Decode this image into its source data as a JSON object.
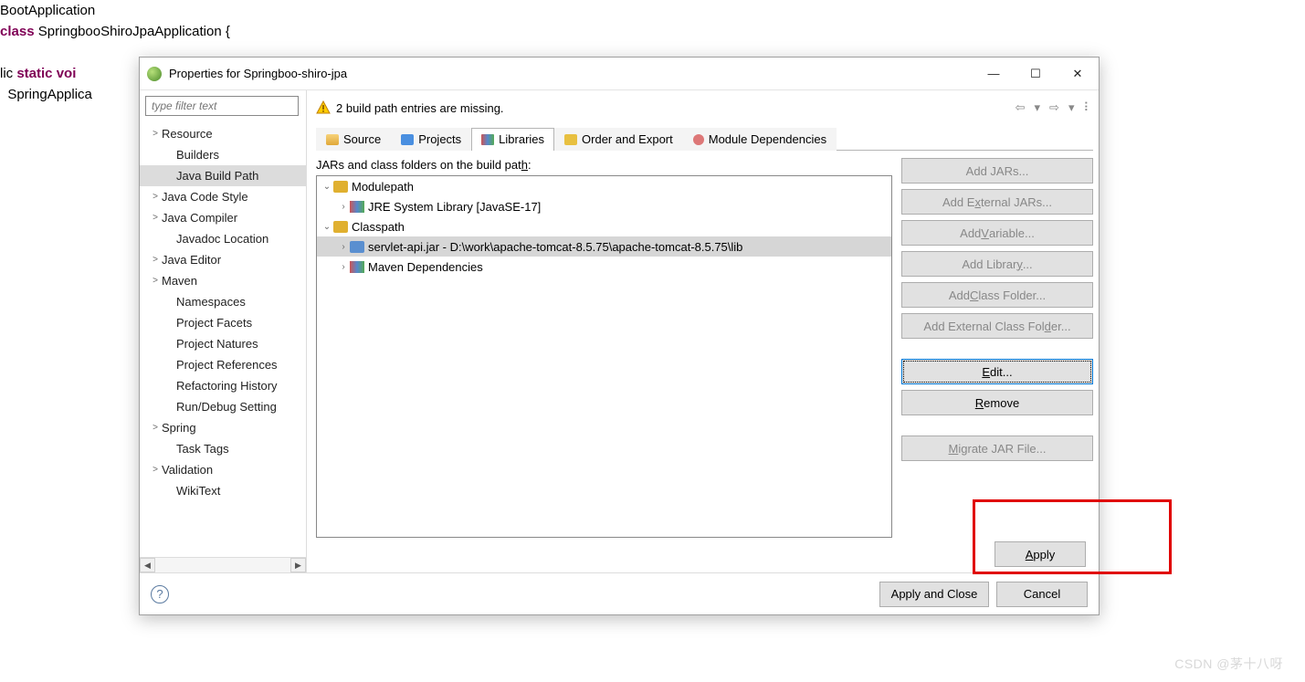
{
  "code": {
    "l1": "BootApplication",
    "l2a": "class ",
    "l2b": "SpringbooShiroJpaApplication {",
    "l3a": "lic ",
    "l3b": "static ",
    "l3c": "voi",
    "l4": "  SpringApplica"
  },
  "dialog": {
    "title": "Properties for Springboo-shiro-jpa",
    "filter_placeholder": "type filter text",
    "nav": [
      {
        "label": "Resource",
        "exp": ">",
        "sub": false
      },
      {
        "label": "Builders",
        "exp": "",
        "sub": true
      },
      {
        "label": "Java Build Path",
        "exp": "",
        "sub": true,
        "sel": true
      },
      {
        "label": "Java Code Style",
        "exp": ">",
        "sub": false
      },
      {
        "label": "Java Compiler",
        "exp": ">",
        "sub": false
      },
      {
        "label": "Javadoc Location",
        "exp": "",
        "sub": true
      },
      {
        "label": "Java Editor",
        "exp": ">",
        "sub": false
      },
      {
        "label": "Maven",
        "exp": ">",
        "sub": false
      },
      {
        "label": "Namespaces",
        "exp": "",
        "sub": true
      },
      {
        "label": "Project Facets",
        "exp": "",
        "sub": true
      },
      {
        "label": "Project Natures",
        "exp": "",
        "sub": true
      },
      {
        "label": "Project References",
        "exp": "",
        "sub": true
      },
      {
        "label": "Refactoring History",
        "exp": "",
        "sub": true
      },
      {
        "label": "Run/Debug Setting",
        "exp": "",
        "sub": true
      },
      {
        "label": "Spring",
        "exp": ">",
        "sub": false
      },
      {
        "label": "Task Tags",
        "exp": "",
        "sub": true
      },
      {
        "label": "Validation",
        "exp": ">",
        "sub": false
      },
      {
        "label": "WikiText",
        "exp": "",
        "sub": true
      }
    ],
    "message": "2 build path entries are missing.",
    "tabs": [
      "Source",
      "Projects",
      "Libraries",
      "Order and Export",
      "Module Dependencies"
    ],
    "active_tab": 2,
    "tree_label_pre": "JARs and class folders on the build pat",
    "tree_label_u": "h",
    "tree_label_post": ":",
    "tree": {
      "modulepath": "Modulepath",
      "jre": "JRE System Library [JavaSE-17]",
      "classpath": "Classpath",
      "servlet": "servlet-api.jar - D:\\work\\apache-tomcat-8.5.75\\apache-tomcat-8.5.75\\lib",
      "maven": "Maven Dependencies"
    },
    "buttons": {
      "add_jars": "Add JARs...",
      "add_ext_pre": "Add E",
      "add_ext_u": "x",
      "add_ext_post": "ternal JARs...",
      "add_var_pre": "Add ",
      "add_var_u": "V",
      "add_var_post": "ariable...",
      "add_lib_pre": "Add Librar",
      "add_lib_u": "y",
      "add_lib_post": "...",
      "add_cf_pre": "Add ",
      "add_cf_u": "C",
      "add_cf_post": "lass Folder...",
      "add_ecf_pre": "Add External Class Fol",
      "add_ecf_u": "d",
      "add_ecf_post": "er...",
      "edit_u": "E",
      "edit_post": "dit...",
      "remove_u": "R",
      "remove_post": "emove",
      "migrate_u": "M",
      "migrate_post": "igrate JAR File...",
      "apply_u": "A",
      "apply_post": "pply"
    },
    "footer": {
      "apply_close": "Apply and Close",
      "cancel": "Cancel"
    }
  },
  "watermark": "CSDN @茅十八呀"
}
